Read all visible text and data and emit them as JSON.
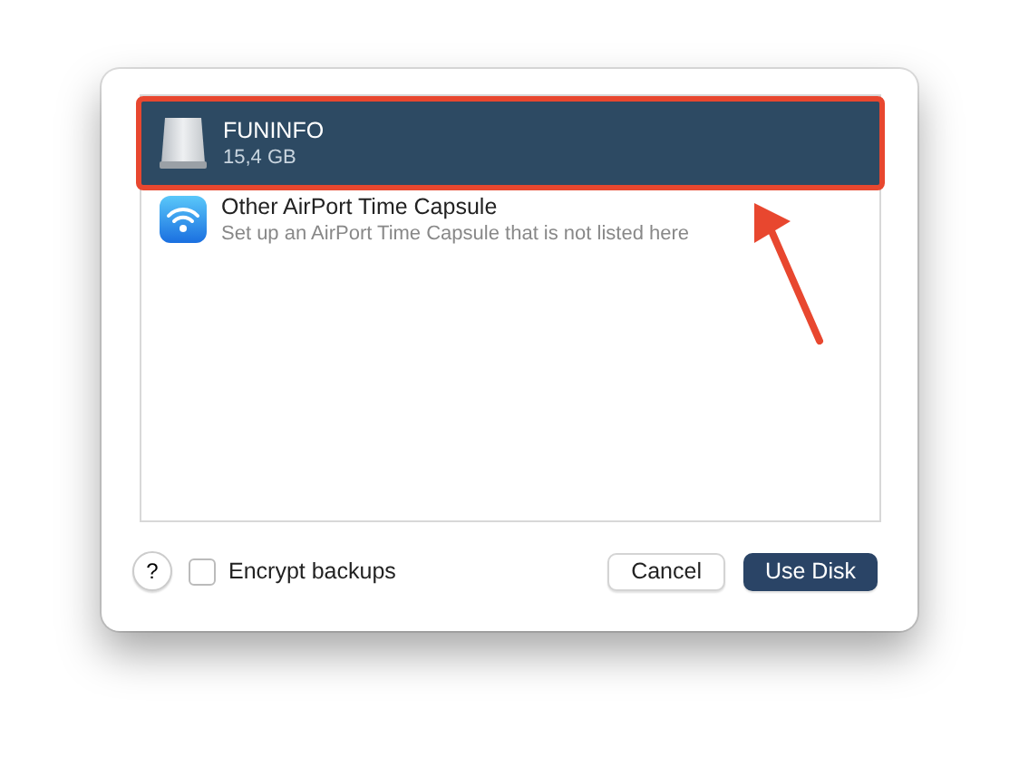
{
  "disks": [
    {
      "kind": "disk",
      "name": "FUNINFO",
      "detail": "15,4 GB",
      "selected": true,
      "highlighted": true
    },
    {
      "kind": "airport",
      "name": "Other AirPort Time Capsule",
      "detail": "Set up an AirPort Time Capsule that is not listed here",
      "selected": false,
      "highlighted": false
    }
  ],
  "help": "?",
  "encrypt": {
    "label": "Encrypt backups",
    "checked": false
  },
  "buttons": [
    {
      "label": "Cancel",
      "kind": "secondary"
    },
    {
      "label": "Use Disk",
      "kind": "primary"
    }
  ]
}
